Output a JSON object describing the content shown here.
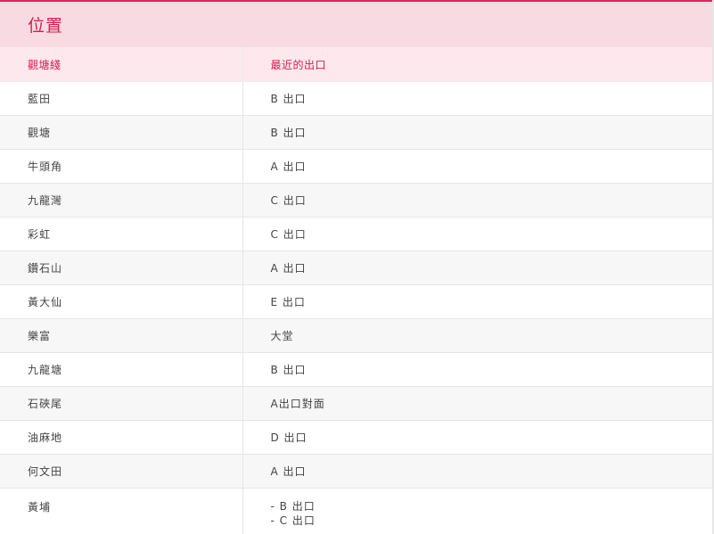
{
  "header": {
    "title": "位置"
  },
  "table": {
    "columns": [
      "觀塘綫",
      "最近的出口"
    ],
    "rows": [
      {
        "station": "藍田",
        "exit": [
          "B 出口"
        ]
      },
      {
        "station": "觀塘",
        "exit": [
          "B 出口"
        ]
      },
      {
        "station": "牛頭角",
        "exit": [
          "A 出口"
        ]
      },
      {
        "station": "九龍灣",
        "exit": [
          "C 出口"
        ]
      },
      {
        "station": "彩虹",
        "exit": [
          "C 出口"
        ]
      },
      {
        "station": "鑽石山",
        "exit": [
          "A 出口"
        ]
      },
      {
        "station": "黃大仙",
        "exit": [
          "E 出口"
        ]
      },
      {
        "station": "樂富",
        "exit": [
          "大堂"
        ]
      },
      {
        "station": "九龍塘",
        "exit": [
          "B 出口"
        ]
      },
      {
        "station": "石硤尾",
        "exit": [
          "A出口對面"
        ]
      },
      {
        "station": "油麻地",
        "exit": [
          "D 出口"
        ]
      },
      {
        "station": "何文田",
        "exit": [
          "A 出口"
        ]
      },
      {
        "station": "黃埔",
        "exit": [
          "- B 出口",
          "- C 出口"
        ]
      }
    ]
  },
  "colors": {
    "accent": "#d81b4f",
    "header_bg": "#f8dbe2",
    "thead_bg": "#fde8ee",
    "row_alt_bg": "#f7f7f7"
  }
}
